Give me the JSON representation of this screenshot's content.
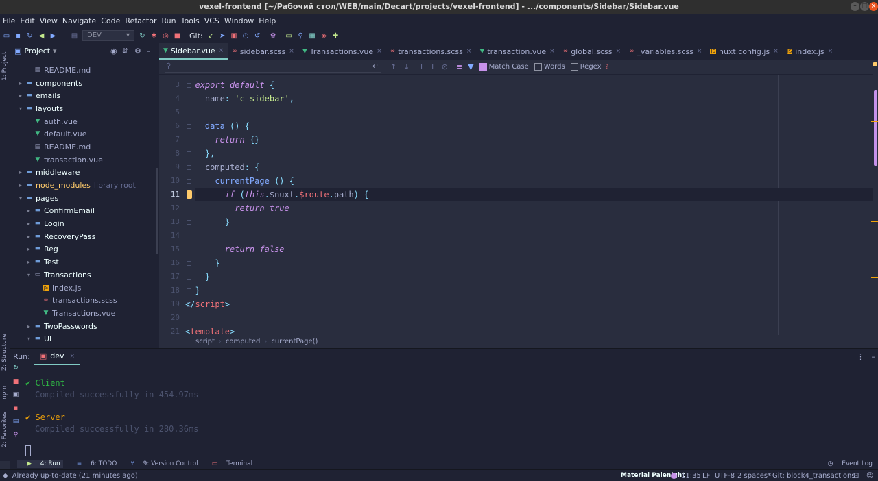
{
  "window": {
    "title": "vexel-frontend [~/Рабочий стол/WEB/main/Decart/projects/vexel-frontend] - .../components/Sidebar/Sidebar.vue"
  },
  "menu": [
    "File",
    "Edit",
    "View",
    "Navigate",
    "Code",
    "Refactor",
    "Run",
    "Tools",
    "VCS",
    "Window",
    "Help"
  ],
  "toolbar": {
    "run_config": "DEV",
    "git_label": "Git:"
  },
  "left_strip": {
    "project": "1: Project",
    "structure": "Z: Structure",
    "npm": "npm",
    "favorites": "2: Favorites"
  },
  "project_panel": {
    "title": "Project",
    "tree": [
      {
        "label": "README.md",
        "depth": 2,
        "type": "md"
      },
      {
        "label": "components",
        "depth": 1,
        "type": "folder",
        "arrow": "▸"
      },
      {
        "label": "emails",
        "depth": 1,
        "type": "folder",
        "arrow": "▸"
      },
      {
        "label": "layouts",
        "depth": 1,
        "type": "folder",
        "arrow": "▾"
      },
      {
        "label": "auth.vue",
        "depth": 2,
        "type": "vue"
      },
      {
        "label": "default.vue",
        "depth": 2,
        "type": "vue"
      },
      {
        "label": "README.md",
        "depth": 2,
        "type": "md"
      },
      {
        "label": "transaction.vue",
        "depth": 2,
        "type": "vue"
      },
      {
        "label": "middleware",
        "depth": 1,
        "type": "folder",
        "arrow": "▸"
      },
      {
        "label": "node_modules",
        "depth": 1,
        "type": "folder",
        "arrow": "▸",
        "extra": "library root"
      },
      {
        "label": "pages",
        "depth": 1,
        "type": "folder",
        "arrow": "▾"
      },
      {
        "label": "ConfirmEmail",
        "depth": 2,
        "type": "folder",
        "arrow": "▸"
      },
      {
        "label": "Login",
        "depth": 2,
        "type": "folder",
        "arrow": "▸"
      },
      {
        "label": "RecoveryPass",
        "depth": 2,
        "type": "folder",
        "arrow": "▸"
      },
      {
        "label": "Reg",
        "depth": 2,
        "type": "folder",
        "arrow": "▸"
      },
      {
        "label": "Test",
        "depth": 2,
        "type": "folder",
        "arrow": "▸"
      },
      {
        "label": "Transactions",
        "depth": 2,
        "type": "folder-open",
        "arrow": "▾"
      },
      {
        "label": "index.js",
        "depth": 3,
        "type": "js"
      },
      {
        "label": "transactions.scss",
        "depth": 3,
        "type": "scss"
      },
      {
        "label": "Transactions.vue",
        "depth": 3,
        "type": "vue"
      },
      {
        "label": "TwoPasswords",
        "depth": 2,
        "type": "folder",
        "arrow": "▸"
      },
      {
        "label": "UI",
        "depth": 2,
        "type": "folder",
        "arrow": "▾"
      }
    ]
  },
  "tabs": [
    {
      "label": "Sidebar.vue",
      "type": "vue",
      "active": true
    },
    {
      "label": "sidebar.scss",
      "type": "scss"
    },
    {
      "label": "Transactions.vue",
      "type": "vue"
    },
    {
      "label": "transactions.scss",
      "type": "scss"
    },
    {
      "label": "transaction.vue",
      "type": "vue"
    },
    {
      "label": "global.scss",
      "type": "scss"
    },
    {
      "label": "_variables.scss",
      "type": "scss"
    },
    {
      "label": "nuxt.config.js",
      "type": "js"
    },
    {
      "label": "index.js",
      "type": "js"
    }
  ],
  "search": {
    "query": "",
    "match_case": "Match Case",
    "words": "Words",
    "regex": "Regex",
    "help": "?"
  },
  "editor": {
    "current_line": 11,
    "lines": [
      {
        "n": 3,
        "html": "  <span class='kw'>export default</span> <span class='pun'>{</span>"
      },
      {
        "n": 4,
        "html": "    name<span class='pun'>:</span> <span class='str'>'c-sidebar'</span><span class='pun'>,</span>"
      },
      {
        "n": 5,
        "html": ""
      },
      {
        "n": 6,
        "html": "    <span class='fn'>data</span> <span class='pun'>()</span> <span class='pun'>{</span>"
      },
      {
        "n": 7,
        "html": "      <span class='kw'>return</span> <span class='pun'>{}</span>"
      },
      {
        "n": 8,
        "html": "    <span class='pun'>},</span>"
      },
      {
        "n": 9,
        "html": "    computed<span class='pun'>:</span> <span class='pun'>{</span>"
      },
      {
        "n": 10,
        "html": "      <span class='fn'>currentPage</span> <span class='pun'>()</span> <span class='pun'>{</span>"
      },
      {
        "n": 11,
        "html": "        <span class='kw'>if</span> <span class='pun'>(</span><span class='kw'>this</span><span class='pun'>.</span>$nuxt<span class='pun'>.</span><span class='tag'>$route</span><span class='pun'>.</span>path<span class='pun'>)</span> <span class='pun'>{</span>"
      },
      {
        "n": 12,
        "html": "          <span class='kw'>return true</span>"
      },
      {
        "n": 13,
        "html": "        <span class='pun'>}</span>"
      },
      {
        "n": 14,
        "html": ""
      },
      {
        "n": 15,
        "html": "        <span class='kw'>return false</span>"
      },
      {
        "n": 16,
        "html": "      <span class='pun'>}</span>"
      },
      {
        "n": 17,
        "html": "    <span class='pun'>}</span>"
      },
      {
        "n": 18,
        "html": "  <span class='pun'>}</span>"
      },
      {
        "n": 19,
        "html": "<span class='pun'>&lt;/</span><span class='tag'>script</span><span class='pun'>&gt;</span>"
      },
      {
        "n": 20,
        "html": ""
      },
      {
        "n": 21,
        "html": "<span class='pun'>&lt;</span><span class='tag'>template</span><span class='pun'>&gt;</span>"
      }
    ]
  },
  "breadcrumb": [
    "script",
    "computed",
    "currentPage()"
  ],
  "run": {
    "label": "Run:",
    "tab": "dev",
    "client_title": "✔ Client",
    "client_msg": "Compiled successfully in 454.97ms",
    "server_title": "✔ Server",
    "server_msg": "Compiled successfully in 280.36ms"
  },
  "bottom_tabs": [
    "4: Run",
    "6: TODO",
    "9: Version Control",
    "Terminal"
  ],
  "event_log": "Event Log",
  "status": {
    "message": "Already up-to-date (21 minutes ago)",
    "theme": "Material Palenight",
    "position": "11:35",
    "line_sep": "LF",
    "encoding": "UTF-8",
    "indent": "2 spaces*",
    "git_branch": "Git: block4_transactions"
  },
  "colors": {
    "accent": "#80CBC4",
    "keyword": "#C792EA",
    "string": "#C3E88D",
    "function": "#82AAFF",
    "client_ok": "#2FB344",
    "server_warn": "#F0A30A"
  }
}
